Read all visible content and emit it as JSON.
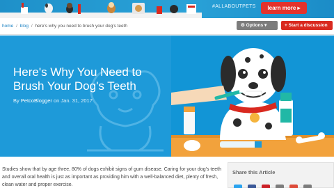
{
  "banner": {
    "hashtag": "#ALLABOUTPETS",
    "cta_label": "learn more ▸"
  },
  "breadcrumb": {
    "items": [
      "home",
      "blog",
      "here's why you need to brush your dog's teeth"
    ],
    "separator": "/"
  },
  "toolbar": {
    "options_label": "Options",
    "discussion_label": "Start a discussion"
  },
  "article": {
    "title": "Here's Why You Need to Brush Your Dog's Teeth",
    "byline_prefix": "By",
    "author": "PetcoBlogger",
    "date_prefix": "on",
    "date": "Jan. 31, 2017",
    "intro": "Studies show that by age three, 80% of dogs exhibit signs of gum disease. Caring for your dog's teeth and overall oral health is just as important as providing him with a well-balanced diet, plenty of fresh, clean water and proper exercise."
  },
  "share": {
    "title": "Share this Article"
  },
  "colors": {
    "banner_blue": "#2aa2d8",
    "hero_blue": "#1e9ad9",
    "brand_red": "#d9291f",
    "options_gray": "#7c7c7c",
    "link_blue": "#1f84c4"
  },
  "icons": [
    "gear-icon",
    "plus-icon",
    "twitter-icon",
    "facebook-icon",
    "pinterest-icon",
    "email-icon",
    "google-plus-icon",
    "share-icon"
  ]
}
